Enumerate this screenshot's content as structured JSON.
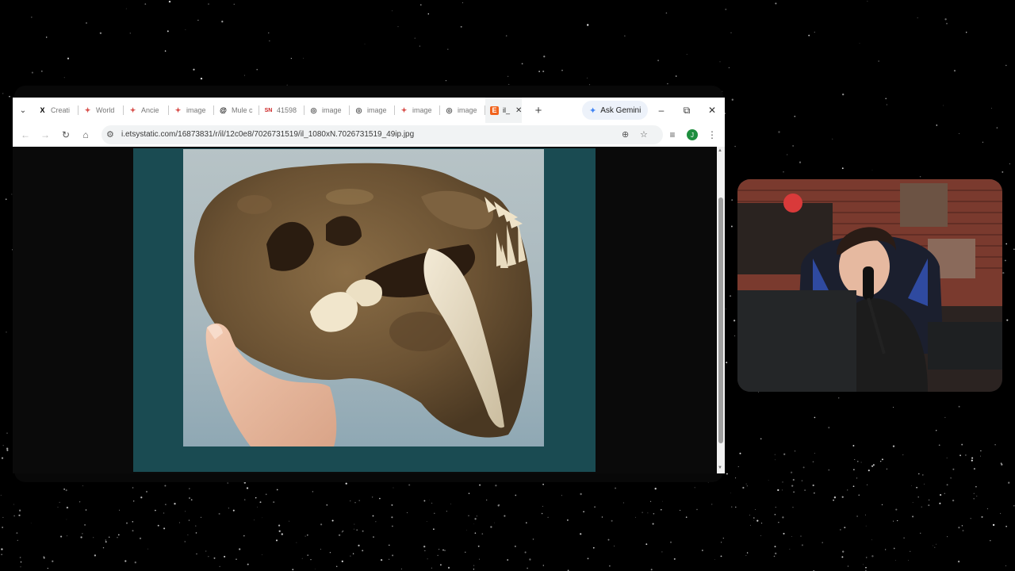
{
  "browser": {
    "tabs": [
      {
        "label": "Creati",
        "icon": "x-logo-icon"
      },
      {
        "label": "World",
        "icon": "ai-logo-icon"
      },
      {
        "label": "Ancie",
        "icon": "ai-logo-icon"
      },
      {
        "label": "image",
        "icon": "ai-logo-icon"
      },
      {
        "label": "Mule c",
        "icon": "threads-logo-icon"
      },
      {
        "label": "41598",
        "icon": "sn-logo-icon"
      },
      {
        "label": "image",
        "icon": "globe-icon"
      },
      {
        "label": "image",
        "icon": "globe-icon"
      },
      {
        "label": "image",
        "icon": "ai-logo-icon"
      },
      {
        "label": "image",
        "icon": "globe-icon"
      },
      {
        "label": "il_",
        "icon": "etsy-logo-icon",
        "active": true
      }
    ],
    "ask_gemini": "Ask Gemini",
    "url": "i.etsystatic.com/16873831/r/il/12c0e8/7026731519/il_1080xN.7026731519_49ip.jpg",
    "profile_initial": "J"
  },
  "content": {
    "image_description": "Fossil saber-toothed cat skull held in a hand"
  },
  "colors": {
    "frame_background": "#1a4b52",
    "accent_gemini": "#4285f4"
  }
}
